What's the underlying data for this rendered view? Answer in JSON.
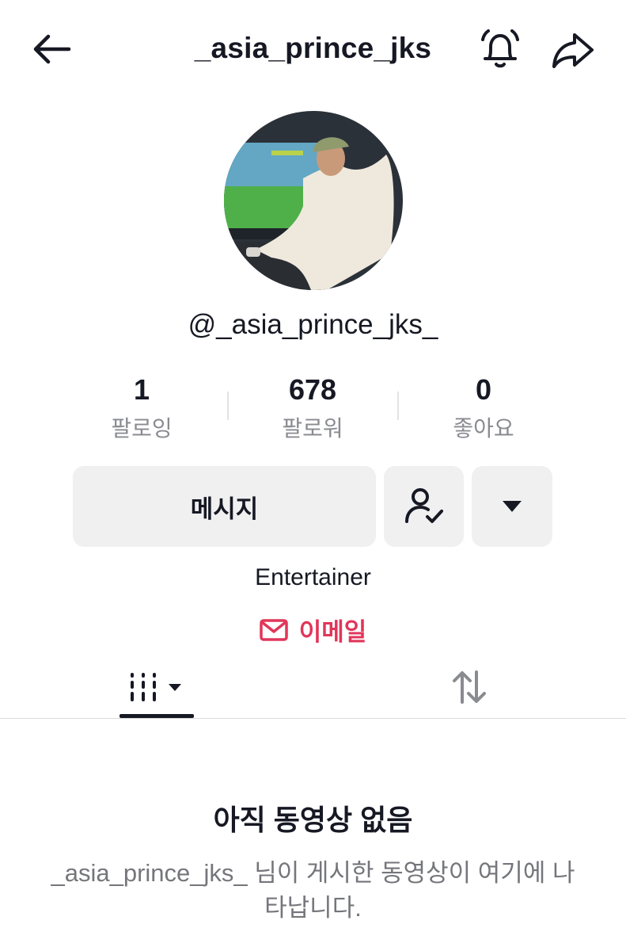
{
  "header": {
    "title": "_asia_prince_jks",
    "back_icon": "arrow-left-icon",
    "bell_icon": "bell-icon",
    "share_icon": "share-arrow-icon"
  },
  "profile": {
    "handle": "@_asia_prince_jks_",
    "bio": "Entertainer",
    "email_label": "이메일"
  },
  "stats": [
    {
      "value": "1",
      "label": "팔로잉"
    },
    {
      "value": "678",
      "label": "팔로워"
    },
    {
      "value": "0",
      "label": "좋아요"
    }
  ],
  "actions": {
    "message_label": "메시지",
    "follow_icon": "user-check-icon",
    "more_icon": "caret-down-icon"
  },
  "tabs": [
    {
      "name": "videos",
      "icon": "grid-columns-icon"
    },
    {
      "name": "reposts",
      "icon": "repost-icon"
    }
  ],
  "empty_state": {
    "title": "아직 동영상 없음",
    "description": "_asia_prince_jks_ 님이 게시한 동영상이 여기에 나타납니다."
  },
  "colors": {
    "accent": "#e1365a",
    "button_bg": "#f0f0f1",
    "secondary_text": "#8a8b91"
  }
}
